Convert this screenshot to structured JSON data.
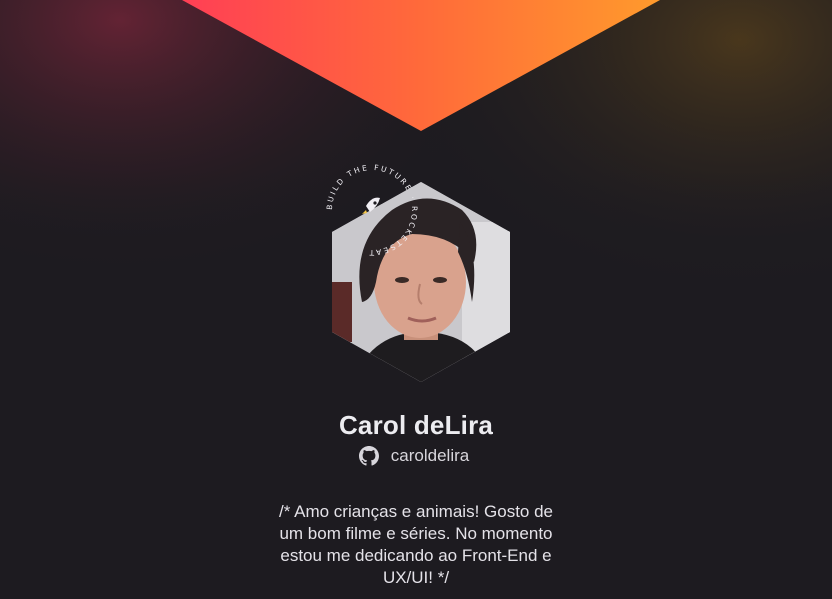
{
  "profile": {
    "name": "Carol deLira",
    "github_handle": "caroldelira",
    "bio": "/* Amo crianças e animais! Gosto de um bom filme e séries. No momento estou me dedicando ao Front-End e UX/UI! */",
    "badge_text": "BUILD THE FUTURE · ROCKETSEAT"
  },
  "icons": {
    "github": "github-icon",
    "rocket": "rocket-icon"
  },
  "colors": {
    "background": "#1d1b20",
    "gradient_start": "#ff5a3a",
    "gradient_end": "#ff8f2e",
    "text": "#ececf0",
    "accent": "#f7c948"
  }
}
